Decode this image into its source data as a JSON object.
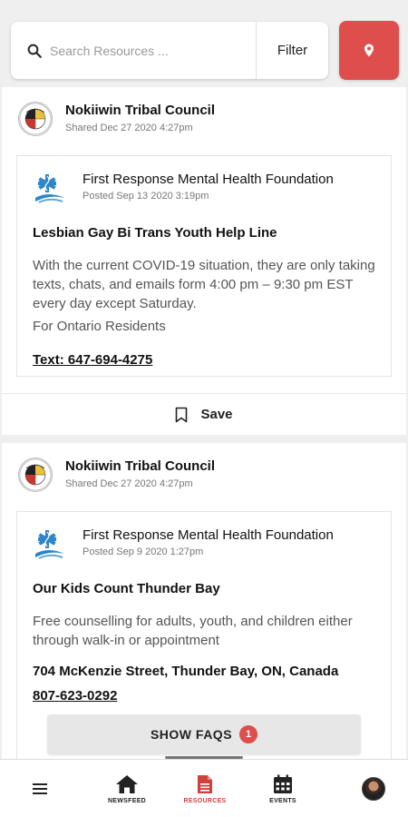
{
  "search": {
    "placeholder": "Search Resources ...",
    "filter_label": "Filter"
  },
  "colors": {
    "accent": "#de4e4d",
    "nav_active": "#d23f3d"
  },
  "posts": [
    {
      "org_name": "Nokiiwin Tribal Council",
      "shared": "Shared Dec 27 2020 4:27pm",
      "foundation_name": "First Response Mental Health Foundation",
      "posted": "Posted Sep 13 2020 3:19pm",
      "title": "Lesbian Gay Bi Trans Youth Help Line",
      "description": "With the current COVID-19 situation, they are only taking texts, chats, and emails form 4:00 pm – 9:30 pm EST every day except Saturday.",
      "extra": "For Ontario Residents",
      "contact": "Text: 647-694-4275",
      "save_label": "Save"
    },
    {
      "org_name": "Nokiiwin Tribal Council",
      "shared": "Shared Dec 27 2020 4:27pm",
      "foundation_name": "First Response Mental Health Foundation",
      "posted": "Posted Sep 9 2020 1:27pm",
      "title": "Our Kids Count Thunder Bay",
      "description": "Free counselling for adults, youth, and children either through walk-in or appointment",
      "address": "704 McKenzie Street, Thunder Bay, ON, Canada",
      "contact": "807-623-0292"
    }
  ],
  "faq": {
    "label": "SHOW FAQS",
    "badge": "1"
  },
  "nav": {
    "menu_icon": "hamburger-menu-icon",
    "items": [
      {
        "label": "NEWSFEED",
        "icon": "home-icon"
      },
      {
        "label": "RESOURCES",
        "icon": "document-icon",
        "active": true
      },
      {
        "label": "EVENTS",
        "icon": "calendar-icon"
      }
    ],
    "avatar_icon": "user-avatar"
  }
}
